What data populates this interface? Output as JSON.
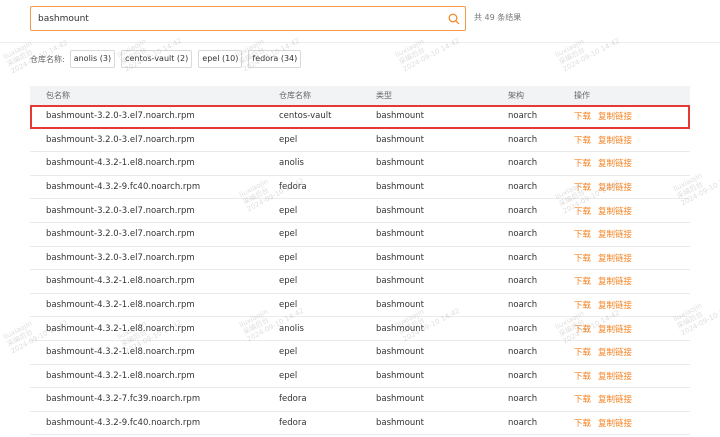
{
  "search": {
    "value": "bashmount",
    "result_count": "共 49 条结果"
  },
  "filter": {
    "label": "仓库名称:",
    "chips": [
      "anolis (3)",
      "centos-vault (2)",
      "epel (10)",
      "fedora (34)"
    ]
  },
  "table": {
    "headers": [
      "包名称",
      "仓库名称",
      "类型",
      "架构",
      "操作"
    ],
    "action_download": "下载",
    "action_copy": "复制链接",
    "rows": [
      [
        "bashmount-3.2.0-3.el7.noarch.rpm",
        "centos-vault",
        "bashmount",
        "noarch"
      ],
      [
        "bashmount-3.2.0-3.el7.noarch.rpm",
        "epel",
        "bashmount",
        "noarch"
      ],
      [
        "bashmount-4.3.2-1.el8.noarch.rpm",
        "anolis",
        "bashmount",
        "noarch"
      ],
      [
        "bashmount-4.3.2-9.fc40.noarch.rpm",
        "fedora",
        "bashmount",
        "noarch"
      ],
      [
        "bashmount-3.2.0-3.el7.noarch.rpm",
        "epel",
        "bashmount",
        "noarch"
      ],
      [
        "bashmount-3.2.0-3.el7.noarch.rpm",
        "epel",
        "bashmount",
        "noarch"
      ],
      [
        "bashmount-3.2.0-3.el7.noarch.rpm",
        "epel",
        "bashmount",
        "noarch"
      ],
      [
        "bashmount-4.3.2-1.el8.noarch.rpm",
        "epel",
        "bashmount",
        "noarch"
      ],
      [
        "bashmount-4.3.2-1.el8.noarch.rpm",
        "epel",
        "bashmount",
        "noarch"
      ],
      [
        "bashmount-4.3.2-1.el8.noarch.rpm",
        "anolis",
        "bashmount",
        "noarch"
      ],
      [
        "bashmount-4.3.2-1.el8.noarch.rpm",
        "epel",
        "bashmount",
        "noarch"
      ],
      [
        "bashmount-4.3.2-1.el8.noarch.rpm",
        "epel",
        "bashmount",
        "noarch"
      ],
      [
        "bashmount-4.3.2-7.fc39.noarch.rpm",
        "fedora",
        "bashmount",
        "noarch"
      ],
      [
        "bashmount-4.3.2-9.fc40.noarch.rpm",
        "fedora",
        "bashmount",
        "noarch"
      ]
    ]
  },
  "watermark": {
    "lines": [
      "liuxiaojin",
      "采编后台",
      "2024-09-10 14:42"
    ]
  },
  "colors": {
    "accent": "#f58220",
    "highlight_border": "#e53935",
    "header_bg": "#f2f3f5"
  }
}
